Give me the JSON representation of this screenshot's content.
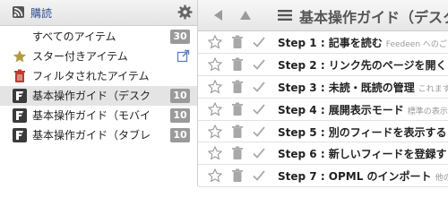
{
  "sidebar": {
    "header": {
      "subscribe_label": "購読"
    },
    "items": [
      {
        "label": "すべてのアイテム",
        "count": "30"
      },
      {
        "label": "スター付きアイテム"
      },
      {
        "label": "フィルタされたアイテム"
      },
      {
        "label": "基本操作ガイド（デスク",
        "count": "10"
      },
      {
        "label": "基本操作ガイド（モバイ",
        "count": "10"
      },
      {
        "label": "基本操作ガイド（タブレ",
        "count": "10"
      }
    ]
  },
  "main": {
    "feed_title": "基本操作ガイド（デスク",
    "articles": [
      {
        "title": "Step 1 : 記事を読む",
        "snippet": "Feedeen へのご"
      },
      {
        "title": "Step 2 : リンク先のページを開く",
        "snippet": ""
      },
      {
        "title": "Step 3 : 未読・既読の管理",
        "snippet": "これます"
      },
      {
        "title": "Step 4 : 展開表示モード",
        "snippet": "標準の表示"
      },
      {
        "title": "Step 5 : 別のフィードを表示する",
        "snippet": ""
      },
      {
        "title": "Step 6 : 新しいフィードを登録す",
        "snippet": ""
      },
      {
        "title": "Step 7 : OPML のインポート",
        "snippet": "他の"
      }
    ]
  },
  "colors": {
    "accent": "#2c4f8f",
    "badge": "#9a9a9a",
    "star": "#b59a45",
    "trash": "#c0392b"
  }
}
